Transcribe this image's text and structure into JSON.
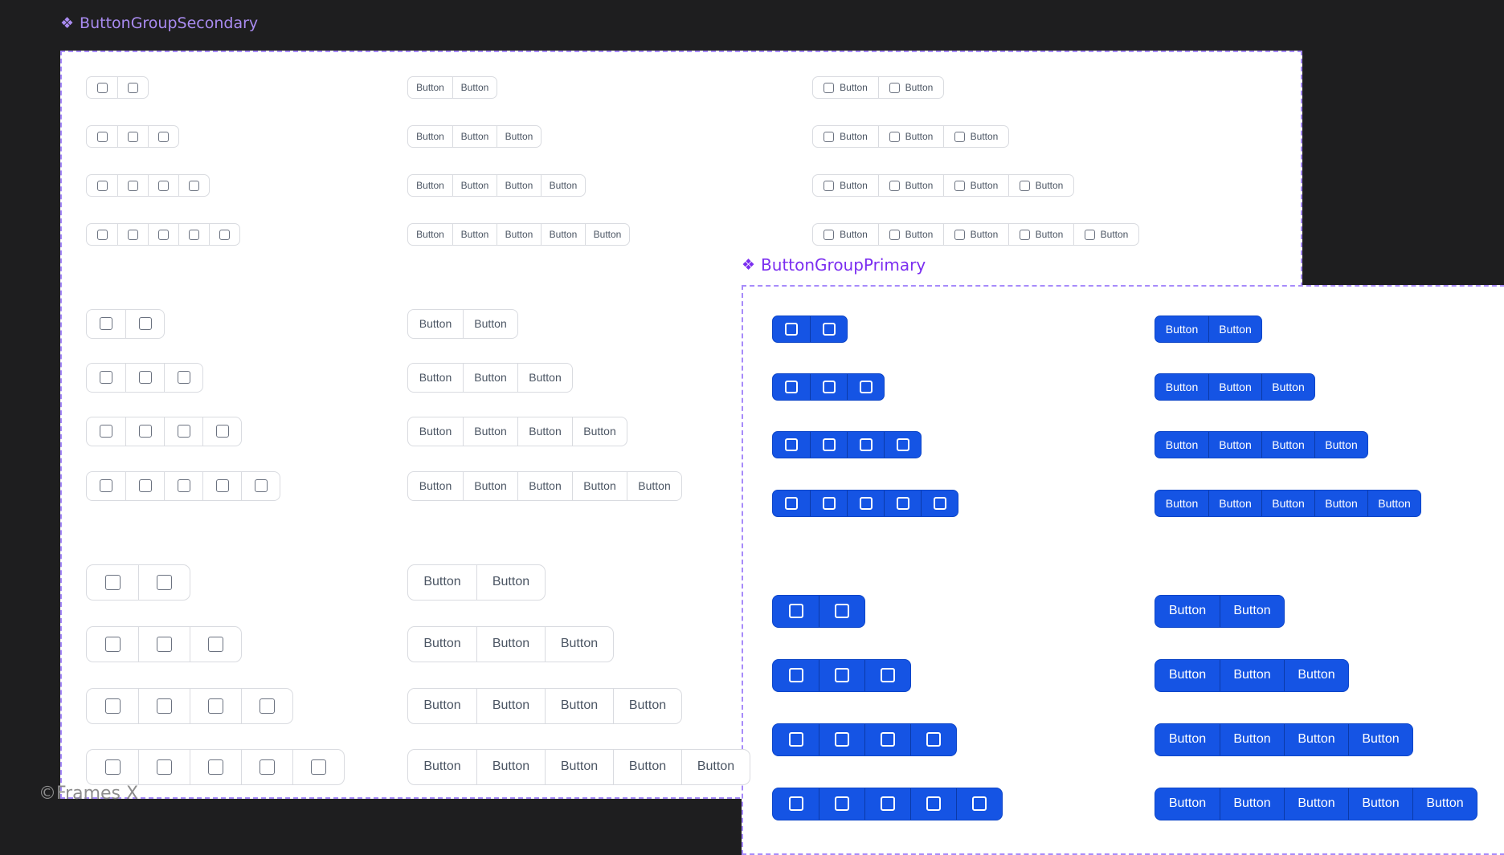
{
  "secondary": {
    "title": "ButtonGroupSecondary",
    "title_icon": "component-icon"
  },
  "primary": {
    "title": "ButtonGroupPrimary",
    "title_icon": "component-icon"
  },
  "button_label": "Button",
  "segment_icon": "square-icon",
  "colors": {
    "primary_fill": "#1554e4",
    "secondary_border": "#d9dbe0",
    "secondary_text": "#4b5563",
    "frame_outline": "#a78bfa",
    "canvas": "#1e1e1f"
  },
  "groups": {
    "secondary": {
      "small": {
        "icon_only": [
          2,
          3,
          4,
          5
        ],
        "text": [
          2,
          3,
          4,
          5
        ],
        "icon_text": [
          2,
          3,
          4,
          5
        ]
      },
      "medium": {
        "icon_only": [
          2,
          3,
          4,
          5
        ],
        "text": [
          2,
          3,
          4,
          5
        ]
      },
      "large": {
        "icon_only": [
          2,
          3,
          4,
          5
        ],
        "text": [
          2,
          3,
          4,
          5
        ]
      }
    },
    "primary": {
      "medium": {
        "icon_only": [
          2,
          3,
          4,
          5
        ],
        "text": [
          2,
          3,
          4,
          5
        ]
      },
      "large": {
        "icon_only": [
          2,
          3,
          4,
          5
        ],
        "text": [
          2,
          3,
          4,
          5
        ]
      }
    }
  },
  "watermark": "©Frames X"
}
